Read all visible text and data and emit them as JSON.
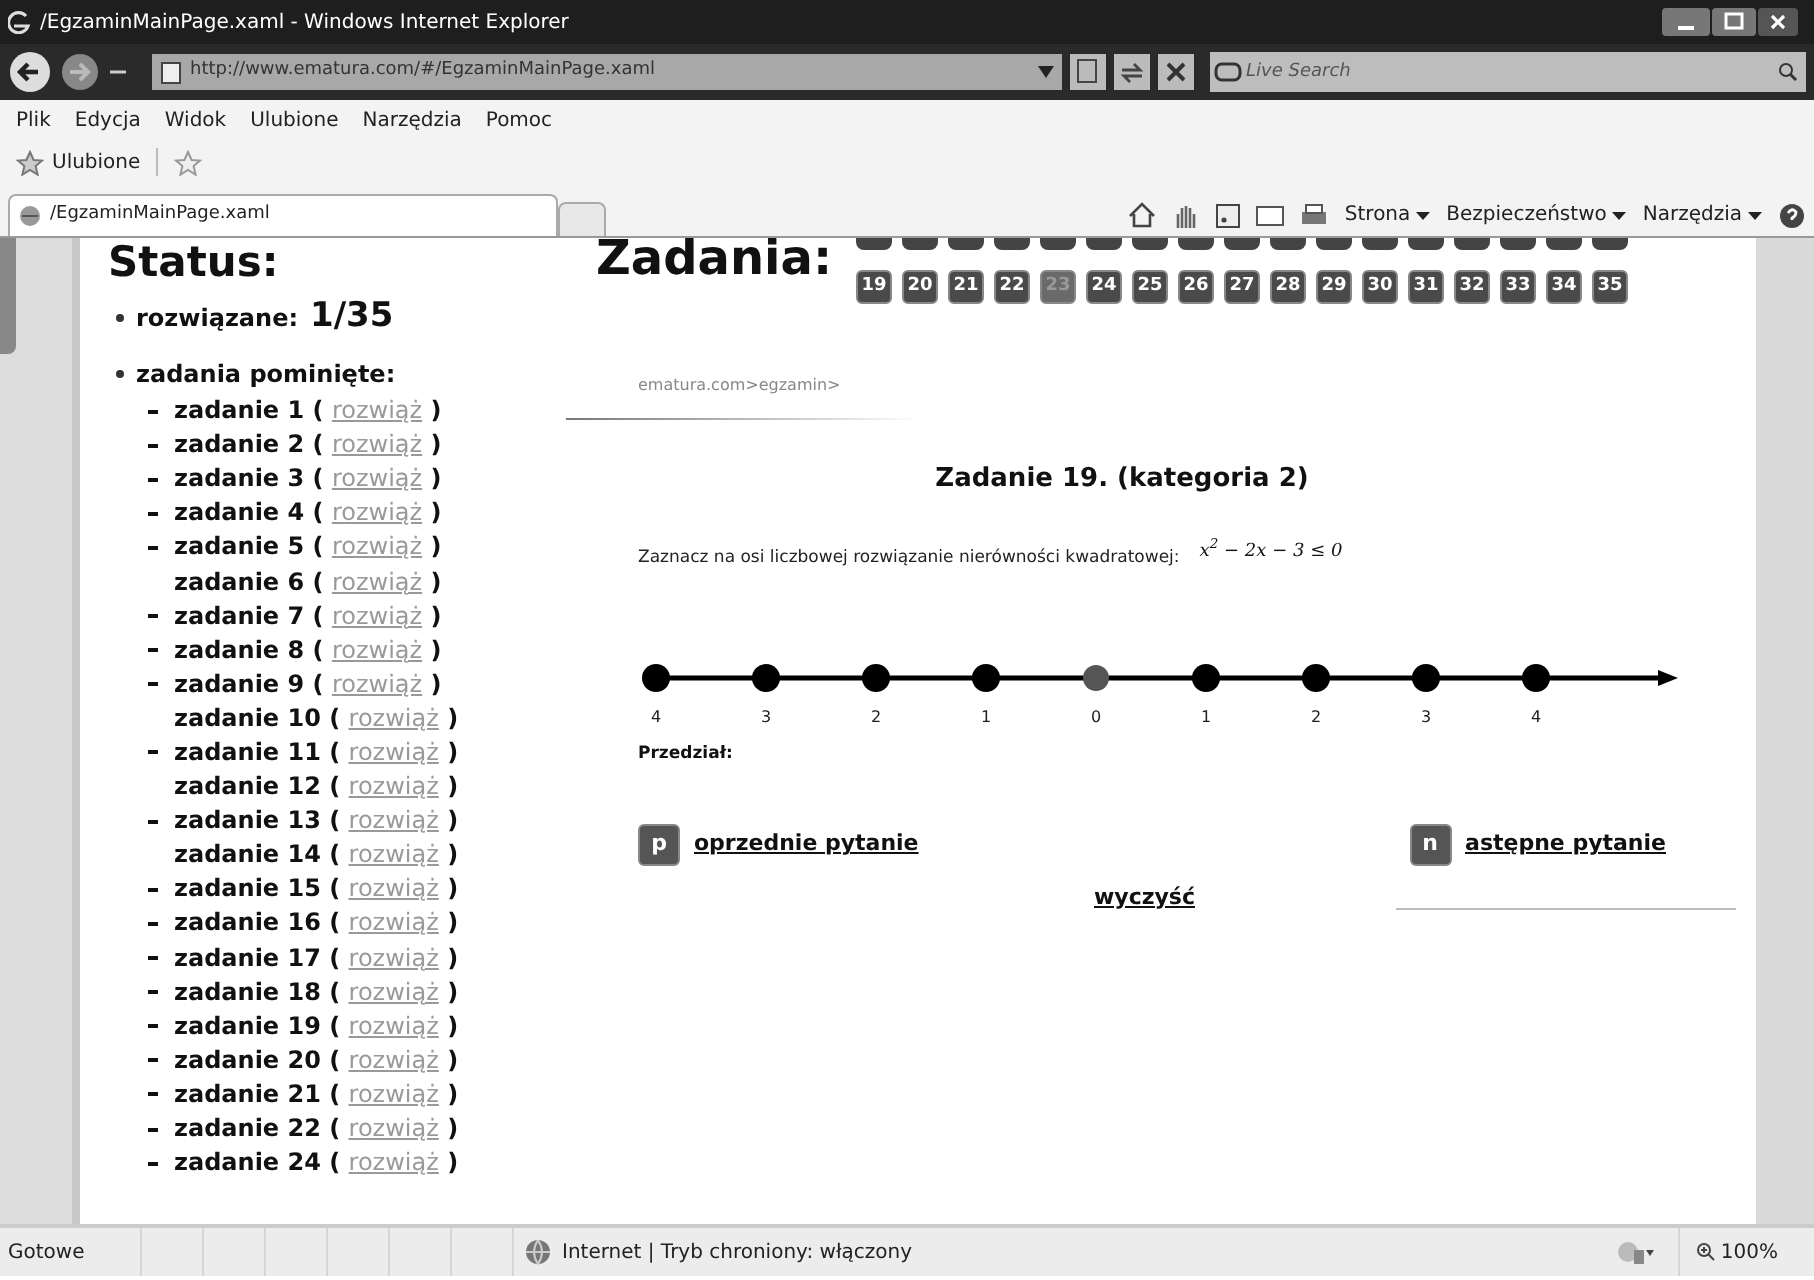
{
  "window": {
    "title": "/EgzaminMainPage.xaml - Windows Internet Explorer"
  },
  "address_bar": {
    "url": "http://www.ematura.com/#/EgzaminMainPage.xaml",
    "search_placeholder": "Live Search"
  },
  "menu": [
    "Plik",
    "Edycja",
    "Widok",
    "Ulubione",
    "Narzędzia",
    "Pomoc"
  ],
  "favorites_bar": {
    "label": "Ulubione"
  },
  "tab": {
    "title": "/EgzaminMainPage.xaml"
  },
  "command_bar": [
    "Strona",
    "Bezpieczeństwo",
    "Narzędzia"
  ],
  "status_panel": {
    "title": "Status:",
    "solved_label": "rozwiązane:",
    "solved_value": "1/35",
    "skipped_label": "zadania pominięte:",
    "skipped": [
      {
        "label": "zadanie 1 (",
        "link": "rozwiąż",
        "close": ")",
        "dash": true
      },
      {
        "label": "zadanie 2 (",
        "link": "rozwiąż",
        "close": ")",
        "dash": true
      },
      {
        "label": "zadanie 3 (",
        "link": "rozwiąż",
        "close": ")",
        "dash": true
      },
      {
        "label": "zadanie 4 (",
        "link": "rozwiąż",
        "close": ")",
        "dash": true
      },
      {
        "label": "zadanie 5 (",
        "link": "rozwiąż",
        "close": ")",
        "dash": true
      },
      {
        "label": "zadanie 6 (",
        "link": "rozwiąż",
        "close": ")",
        "dash": false
      },
      {
        "label": "zadanie 7 (",
        "link": "rozwiąż",
        "close": ")",
        "dash": true
      },
      {
        "label": "zadanie 8 (",
        "link": "rozwiąż",
        "close": ")",
        "dash": true
      },
      {
        "label": "zadanie 9 (",
        "link": "rozwiąż",
        "close": ")",
        "dash": true
      },
      {
        "label": "zadanie 10 (",
        "link": "rozwiąż",
        "close": ")",
        "dash": false
      },
      {
        "label": "zadanie 11 (",
        "link": "rozwiąż",
        "close": ")",
        "dash": true
      },
      {
        "label": "zadanie 12 (",
        "link": "rozwiąż",
        "close": ")",
        "dash": false
      },
      {
        "label": "zadanie 13 (",
        "link": "rozwiąż",
        "close": ")",
        "dash": true
      },
      {
        "label": "zadanie 14 (",
        "link": "rozwiąż",
        "close": ")",
        "dash": false
      },
      {
        "label": "zadanie 15 (",
        "link": "rozwiąż",
        "close": ")",
        "dash": true
      },
      {
        "label": "zadanie 16 (",
        "link": "rozwiąż",
        "close": ")",
        "dash": true
      },
      {
        "label": "zadanie 17 (",
        "link": "rozwiąż",
        "close": ")",
        "dash": true
      },
      {
        "label": "zadanie 18 (",
        "link": "rozwiąż",
        "close": ")",
        "dash": true
      },
      {
        "label": "zadanie 19 (",
        "link": "rozwiąż",
        "close": ")",
        "dash": true
      },
      {
        "label": "zadanie 20 (",
        "link": "rozwiąż",
        "close": ")",
        "dash": true
      },
      {
        "label": "zadanie 21 (",
        "link": "rozwiąż",
        "close": ")",
        "dash": true
      },
      {
        "label": "zadanie 22 (",
        "link": "rozwiąż",
        "close": ")",
        "dash": true
      },
      {
        "label": "zadanie 24 (",
        "link": "rozwiąż",
        "close": ")",
        "dash": true
      }
    ]
  },
  "tasks_panel": {
    "title": "Zadania:",
    "task_buttons": [
      {
        "label": "19",
        "solved": false
      },
      {
        "label": "20",
        "solved": false
      },
      {
        "label": "21",
        "solved": false
      },
      {
        "label": "22",
        "solved": false
      },
      {
        "label": "23",
        "solved": true
      },
      {
        "label": "24",
        "solved": false
      },
      {
        "label": "25",
        "solved": false
      },
      {
        "label": "26",
        "solved": false
      },
      {
        "label": "27",
        "solved": false
      },
      {
        "label": "28",
        "solved": false
      },
      {
        "label": "29",
        "solved": false
      },
      {
        "label": "30",
        "solved": false
      },
      {
        "label": "31",
        "solved": false
      },
      {
        "label": "32",
        "solved": false
      },
      {
        "label": "33",
        "solved": false
      },
      {
        "label": "34",
        "solved": false
      },
      {
        "label": "35",
        "solved": false
      }
    ],
    "breadcrumb": "ematura.com>egzamin>",
    "question_title": "Zadanie 19. (kategoria 2)",
    "instruction": "Zaznacz na osi liczbowej rozwiązanie nierówności kwadratowej:",
    "formula": "x$^{2}$ − 2x − 3 ≤ 0",
    "number_line": [
      {
        "label": "4",
        "highlighted": false
      },
      {
        "label": "3",
        "highlighted": false
      },
      {
        "label": "2",
        "highlighted": false
      },
      {
        "label": "1",
        "highlighted": false
      },
      {
        "label": "0",
        "highlighted": true
      },
      {
        "label": "1",
        "highlighted": false
      },
      {
        "label": "2",
        "highlighted": false
      },
      {
        "label": "3",
        "highlighted": false
      },
      {
        "label": "4",
        "highlighted": false
      }
    ],
    "interval_label": "Przedział:",
    "prev": {
      "key": "p",
      "label": "oprzednie pytanie"
    },
    "next": {
      "key": "n",
      "label": "astępne pytanie"
    },
    "clear": "wyczyść"
  },
  "status_bar": {
    "text": "Gotowe",
    "zone": "Internet | Tryb chroniony: włączony",
    "zoom": "100%"
  }
}
